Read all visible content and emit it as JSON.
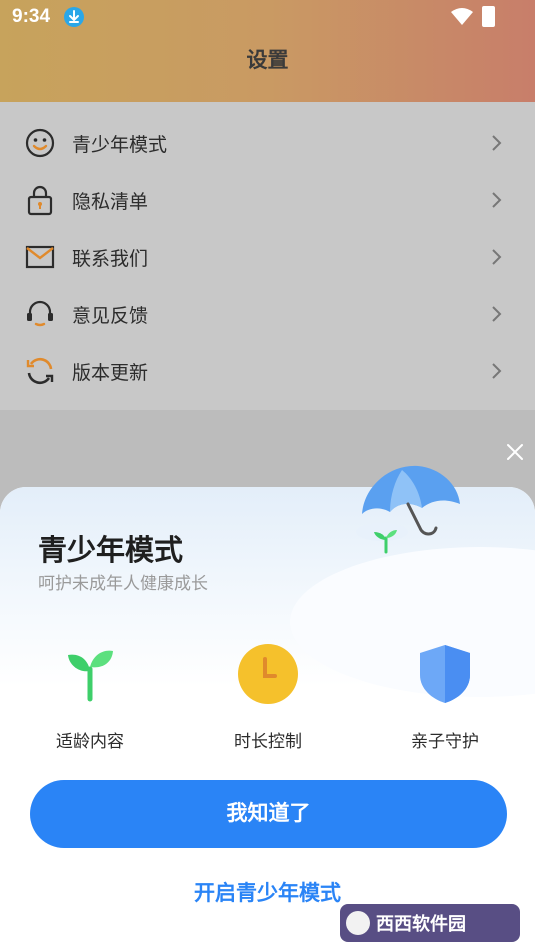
{
  "status_bar": {
    "time": "9:34"
  },
  "header": {
    "title": "设置"
  },
  "menu": {
    "items": [
      {
        "label": "青少年模式",
        "icon": "smiley-face-icon"
      },
      {
        "label": "隐私清单",
        "icon": "lock-icon"
      },
      {
        "label": "联系我们",
        "icon": "mail-icon"
      },
      {
        "label": "意见反馈",
        "icon": "headset-icon"
      },
      {
        "label": "版本更新",
        "icon": "refresh-icon"
      }
    ]
  },
  "dialog": {
    "title": "青少年模式",
    "subtitle": "呵护未成年人健康成长",
    "features": [
      {
        "label": "适龄内容",
        "icon": "sprout-icon"
      },
      {
        "label": "时长控制",
        "icon": "clock-icon"
      },
      {
        "label": "亲子守护",
        "icon": "shield-icon"
      }
    ],
    "primary_button": "我知道了",
    "secondary_link": "开启青少年模式"
  },
  "colors": {
    "accent": "#2a84f6",
    "header_gradient_start": "#c7a35c",
    "header_gradient_end": "#c87e6a",
    "menu_icon_orange": "#e08a2c"
  }
}
